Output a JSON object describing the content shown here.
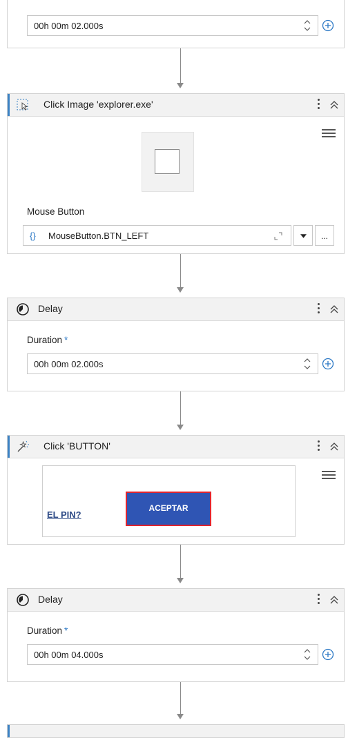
{
  "delay_top": {
    "duration_value": "00h 00m 02.000s"
  },
  "click_image": {
    "title": "Click Image 'explorer.exe'",
    "field_label": "Mouse Button",
    "value_icon": "{}",
    "value": "MouseButton.BTN_LEFT",
    "more_label": "..."
  },
  "delay_1": {
    "title": "Delay",
    "field_label": "Duration",
    "required_mark": "*",
    "duration_value": "00h 00m 02.000s"
  },
  "click_button": {
    "title": "Click 'BUTTON'",
    "preview_link": "EL PIN?",
    "preview_button": "ACEPTAR",
    "preview_button_color": "#2f55b4",
    "preview_button_border": "#e0242e"
  },
  "delay_2": {
    "title": "Delay",
    "field_label": "Duration",
    "required_mark": "*",
    "duration_value": "00h 00m 04.000s"
  },
  "colors": {
    "accent": "#3b82c4",
    "connector": "#8a8a8a",
    "plus_icon": "#2b78c5"
  }
}
